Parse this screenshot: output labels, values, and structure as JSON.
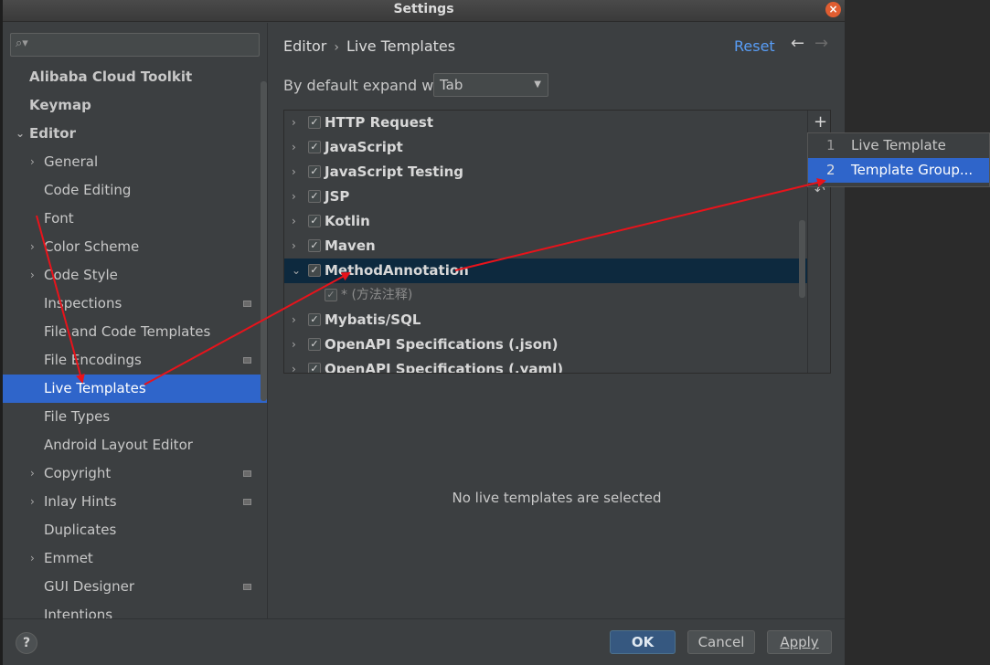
{
  "window": {
    "title": "Settings"
  },
  "search": {
    "placeholder": ""
  },
  "sidebar": {
    "items": [
      {
        "label": "Alibaba Cloud Toolkit",
        "bold": true
      },
      {
        "label": "Keymap",
        "bold": true
      },
      {
        "label": "Editor",
        "bold": true,
        "expanded": true
      },
      {
        "label": "General",
        "expandable": true
      },
      {
        "label": "Code Editing"
      },
      {
        "label": "Font"
      },
      {
        "label": "Color Scheme",
        "expandable": true
      },
      {
        "label": "Code Style",
        "expandable": true
      },
      {
        "label": "Inspections",
        "badge": true
      },
      {
        "label": "File and Code Templates"
      },
      {
        "label": "File Encodings",
        "badge": true
      },
      {
        "label": "Live Templates",
        "selected": true
      },
      {
        "label": "File Types"
      },
      {
        "label": "Android Layout Editor"
      },
      {
        "label": "Copyright",
        "expandable": true,
        "badge": true
      },
      {
        "label": "Inlay Hints",
        "expandable": true,
        "badge": true
      },
      {
        "label": "Duplicates"
      },
      {
        "label": "Emmet",
        "expandable": true
      },
      {
        "label": "GUI Designer",
        "badge": true
      },
      {
        "label": "Intentions"
      }
    ]
  },
  "breadcrumb": {
    "parent": "Editor",
    "separator": "›",
    "current": "Live Templates"
  },
  "toolbar": {
    "reset_label": "Reset",
    "back_icon": "←",
    "forward_icon": "→"
  },
  "expand": {
    "label": "By default expand with",
    "value": "Tab"
  },
  "templates": [
    {
      "name": "HTTP Request",
      "checked": true
    },
    {
      "name": "JavaScript",
      "checked": true
    },
    {
      "name": "JavaScript Testing",
      "checked": true
    },
    {
      "name": "JSP",
      "checked": true
    },
    {
      "name": "Kotlin",
      "checked": true
    },
    {
      "name": "Maven",
      "checked": true
    },
    {
      "name": "MethodAnnotation",
      "checked": true,
      "expanded": true,
      "selected": true
    },
    {
      "name": "* (方法注释)",
      "checked": true,
      "child": true
    },
    {
      "name": "Mybatis/SQL",
      "checked": true
    },
    {
      "name": "OpenAPI Specifications (.json)",
      "checked": true
    },
    {
      "name": "OpenAPI Specifications (.yaml)",
      "checked": true
    }
  ],
  "popup": {
    "items": [
      {
        "num": "1",
        "label": "Live Template"
      },
      {
        "num": "2",
        "label": "Template Group...",
        "selected": true
      }
    ]
  },
  "empty_message": "No live templates are selected",
  "buttons": {
    "help": "?",
    "ok": "OK",
    "cancel": "Cancel",
    "apply": "Apply"
  },
  "colors": {
    "selection": "#2f65ca",
    "accent_link": "#589df6",
    "annotation": "#e8131b"
  }
}
